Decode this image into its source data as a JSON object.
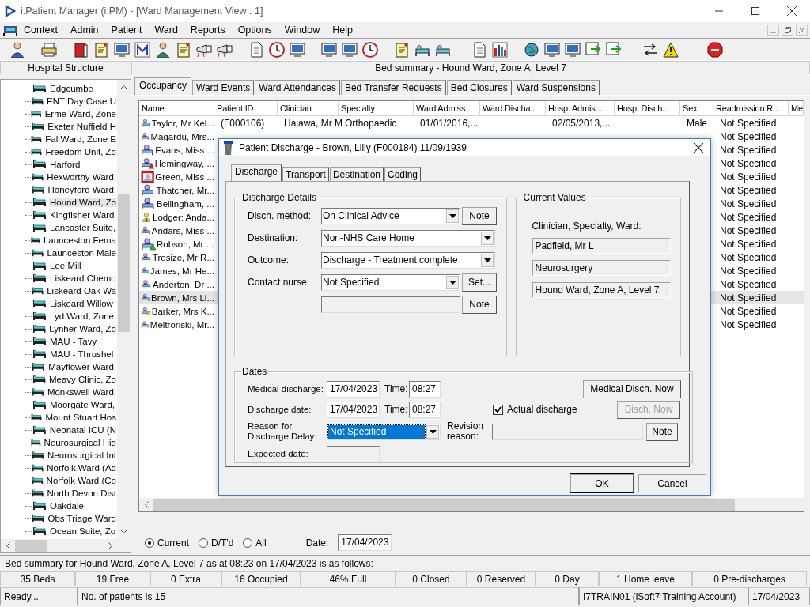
{
  "window": {
    "title": "i.Patient Manager (i.PM) - [Ward Management View : 1]"
  },
  "menu": [
    "Context",
    "Admin",
    "Patient",
    "Ward",
    "Reports",
    "Options",
    "Window",
    "Help"
  ],
  "left_panel": {
    "title": "Hospital Structure",
    "items": [
      {
        "label": "Edgcumbe",
        "selected": false
      },
      {
        "label": "ENT Day Case U",
        "selected": false
      },
      {
        "label": "Erme Ward, Zone",
        "selected": false
      },
      {
        "label": "Exeter Nuffield H",
        "selected": false
      },
      {
        "label": "Fal Ward, Zone E",
        "selected": false
      },
      {
        "label": "Freedom Unit, Zo",
        "selected": false
      },
      {
        "label": "Harford",
        "selected": false
      },
      {
        "label": "Hexworthy Ward,",
        "selected": false
      },
      {
        "label": "Honeyford Ward,",
        "selected": false
      },
      {
        "label": "Hound Ward, Zo",
        "selected": true
      },
      {
        "label": "Kingfisher Ward",
        "selected": false
      },
      {
        "label": "Lancaster Suite,",
        "selected": false
      },
      {
        "label": "Launceston Fema",
        "selected": false
      },
      {
        "label": "Launceston Male",
        "selected": false
      },
      {
        "label": "Lee Mill",
        "selected": false
      },
      {
        "label": "Liskeard Chemo",
        "selected": false
      },
      {
        "label": "Liskeard Oak Wa",
        "selected": false
      },
      {
        "label": "Liskeard Willow",
        "selected": false
      },
      {
        "label": "Lyd Ward, Zone",
        "selected": false
      },
      {
        "label": "Lynher Ward, Zo",
        "selected": false
      },
      {
        "label": "MAU - Tavy",
        "selected": false
      },
      {
        "label": "MAU - Thrushel",
        "selected": false
      },
      {
        "label": "Mayflower Ward,",
        "selected": false
      },
      {
        "label": "Meavy Clinic, Zo",
        "selected": false
      },
      {
        "label": "Monkswell Ward,",
        "selected": false
      },
      {
        "label": "Moorgate Ward,",
        "selected": false
      },
      {
        "label": "Mount Stuart Hos",
        "selected": false
      },
      {
        "label": "Neonatal ICU (N",
        "selected": false
      },
      {
        "label": "Neurosurgical Hig",
        "selected": false
      },
      {
        "label": "Neurosurgical Int",
        "selected": false
      },
      {
        "label": "Norfolk Ward (Ad",
        "selected": false
      },
      {
        "label": "Norfolk Ward (Co",
        "selected": false
      },
      {
        "label": "North Devon Dist",
        "selected": false
      },
      {
        "label": "Oakdale",
        "selected": false
      },
      {
        "label": "Obs Triage Ward",
        "selected": false
      },
      {
        "label": "Ocean Suite, Zo",
        "selected": false
      }
    ]
  },
  "main": {
    "title": "Bed summary - Hound Ward, Zone A, Level 7",
    "tabs": [
      {
        "label": "Occupancy",
        "selected": true
      },
      {
        "label": "Ward Events",
        "selected": false
      },
      {
        "label": "Ward Attendances",
        "selected": false
      },
      {
        "label": "Bed Transfer Requests",
        "selected": false
      },
      {
        "label": "Bed Closures",
        "selected": false
      },
      {
        "label": "Ward Suspensions",
        "selected": false
      }
    ],
    "table": {
      "columns": [
        "Name",
        "Patient ID",
        "Clinician",
        "Specialty",
        "Ward Admiss...",
        "Ward Discha...",
        "Hosp. Admis...",
        "Hosp. Disch...",
        "Sex",
        "Readmission R...",
        "Me"
      ],
      "rows": [
        {
          "kind": "none",
          "selected": false,
          "name": "Taylor, Mr Kel...",
          "patient_id": "(F000106)",
          "clinician": "Halawa, Mr M",
          "specialty": "Orthopaedic",
          "ward_admission": "01/01/2016,...",
          "hosp_admission": "02/05/2013,...",
          "sex": "Male",
          "readmission": "Not Specified"
        },
        {
          "kind": "none",
          "selected": false,
          "name": "Magardu, Mrs...",
          "readmission": "Not Specified"
        },
        {
          "kind": "none",
          "selected": false,
          "name": "Evans, Miss ...",
          "readmission": "Not Specified"
        },
        {
          "kind": "red-triangle",
          "selected": false,
          "name": "Hemingway, ...",
          "readmission": "Not Specified"
        },
        {
          "kind": "red-box",
          "selected": false,
          "name": "Green, Miss ...",
          "readmission": "Not Specified"
        },
        {
          "kind": "none",
          "selected": false,
          "name": "Thatcher, Mr...",
          "readmission": "Not Specified"
        },
        {
          "kind": "none",
          "selected": false,
          "name": "Bellingham, ...",
          "readmission": "Not Specified"
        },
        {
          "kind": "yellow-person",
          "selected": false,
          "name": "Lodger: Anda...",
          "readmission": "Not Specified"
        },
        {
          "kind": "none",
          "selected": false,
          "name": "Andars, Miss ...",
          "readmission": "Not Specified"
        },
        {
          "kind": "green-triangle",
          "selected": false,
          "name": "Robson, Mr ...",
          "readmission": "Not Specified"
        },
        {
          "kind": "none",
          "selected": false,
          "name": "Tresize, Mr R...",
          "readmission": "Not Specified"
        },
        {
          "kind": "none",
          "selected": false,
          "name": "James, Mr He...",
          "readmission": "Not Specified"
        },
        {
          "kind": "none",
          "selected": false,
          "name": "Anderton, Dr ...",
          "readmission": "Not Specified"
        },
        {
          "kind": "none",
          "selected": true,
          "name": "Brown, Mrs Li...",
          "readmission": "Not Specified"
        },
        {
          "kind": "yellow-triangle",
          "selected": false,
          "name": "Barker, Mrs K...",
          "readmission": "Not Specified"
        },
        {
          "kind": "none",
          "selected": false,
          "name": "Meltroriski, Mr...",
          "readmission": "Not Specified"
        }
      ]
    },
    "filters": [
      {
        "label": "Current",
        "selected": true
      },
      {
        "label": "D/T'd",
        "selected": false
      },
      {
        "label": "All",
        "selected": false
      }
    ],
    "date": {
      "label": "Date:",
      "value": "17/04/2023"
    }
  },
  "dialog": {
    "title": "Patient Discharge - Brown, Lilly (F000184) 11/09/1939",
    "tabs": [
      {
        "label": "Discharge",
        "selected": true
      },
      {
        "label": "Transport",
        "selected": false
      },
      {
        "label": "Destination",
        "selected": false
      },
      {
        "label": "Coding",
        "selected": false
      }
    ],
    "details": {
      "legend": "Discharge Details",
      "rows": [
        {
          "label": "Disch. method:",
          "value": "On Clinical Advice",
          "button": "Note"
        },
        {
          "label": "Destination:",
          "value": "Non-NHS Care Home"
        },
        {
          "label": "Outcome:",
          "value": "Discharge - Treatment complete"
        },
        {
          "label": "Contact nurse:",
          "value": "Not Specified",
          "button": "Set..."
        }
      ],
      "extra": {
        "disabled": true,
        "button": "Note"
      }
    },
    "current": {
      "legend": "Current Values",
      "caption": "Clinician, Specialty, Ward:",
      "values": [
        "Padfield, Mr L",
        "Neurosurgery",
        "Hound Ward, Zone A, Level 7"
      ]
    },
    "dates": {
      "legend": "Dates",
      "medical": {
        "label": "Medical discharge:",
        "date": "17/04/2023",
        "time_label": "Time:",
        "time": "08:27",
        "button": "Medical Disch. Now"
      },
      "discharge": {
        "label": "Discharge date:",
        "date": "17/04/2023",
        "time_label": "Time:",
        "time": "08:27",
        "check_label": "Actual discharge",
        "checked": true,
        "button": "Disch. Now",
        "disabled": true
      },
      "reason": {
        "label": "Reason for Discharge Delay:",
        "value": "Not Specified",
        "focused": true,
        "revision_label": "Revision reason:",
        "button": "Note"
      },
      "expected": {
        "label": "Expected date:",
        "disabled": true
      }
    },
    "buttons": [
      "OK",
      "Cancel"
    ]
  },
  "summary": "Bed summary for Hound Ward, Zone A, Level 7 as at 08:23 on 17/04/2023 is as follows:",
  "counts": [
    "35 Beds",
    "19 Free",
    "0 Extra",
    "16 Occupied",
    "46% Full",
    "0 Closed",
    "0 Reserved",
    "0 Day",
    "1 Home leave",
    "0 Pre-discharges"
  ],
  "status_bar": [
    "Ready...",
    "No. of patients is 15",
    "I7TRAIN01 (iSoft7 Training Account)",
    "17/04/2023"
  ]
}
